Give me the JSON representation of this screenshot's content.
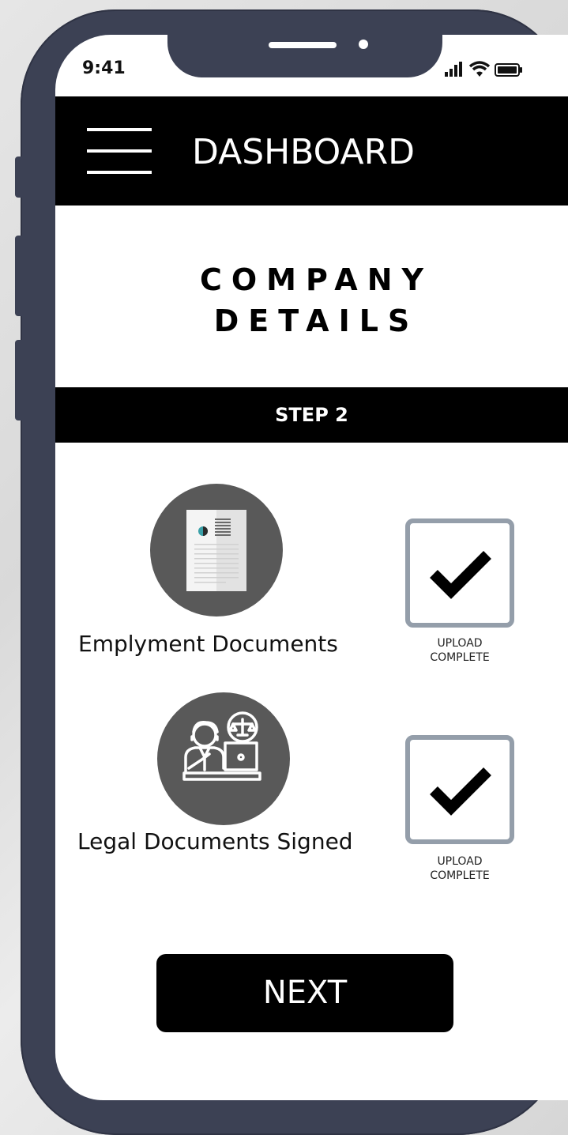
{
  "status_bar": {
    "time": "9:41"
  },
  "header": {
    "title": "DASHBOARD",
    "menu_icon": "hamburger-menu-icon"
  },
  "page": {
    "title_line1": "COMPANY",
    "title_line2": "DETAILS",
    "step": "STEP 2"
  },
  "documents": [
    {
      "label": "Emplyment Documents",
      "icon": "document-icon",
      "status_line1": "UPLOAD",
      "status_line2": "COMPLETE"
    },
    {
      "label": "Legal Documents Signed",
      "icon": "lawyer-icon",
      "status_line1": "UPLOAD",
      "status_line2": "COMPLETE"
    }
  ],
  "actions": {
    "next_label": "NEXT"
  },
  "colors": {
    "frame": "#3c4154",
    "icon_circle": "#595959",
    "checkbox_border": "#949eaa",
    "bars": "#000000"
  }
}
